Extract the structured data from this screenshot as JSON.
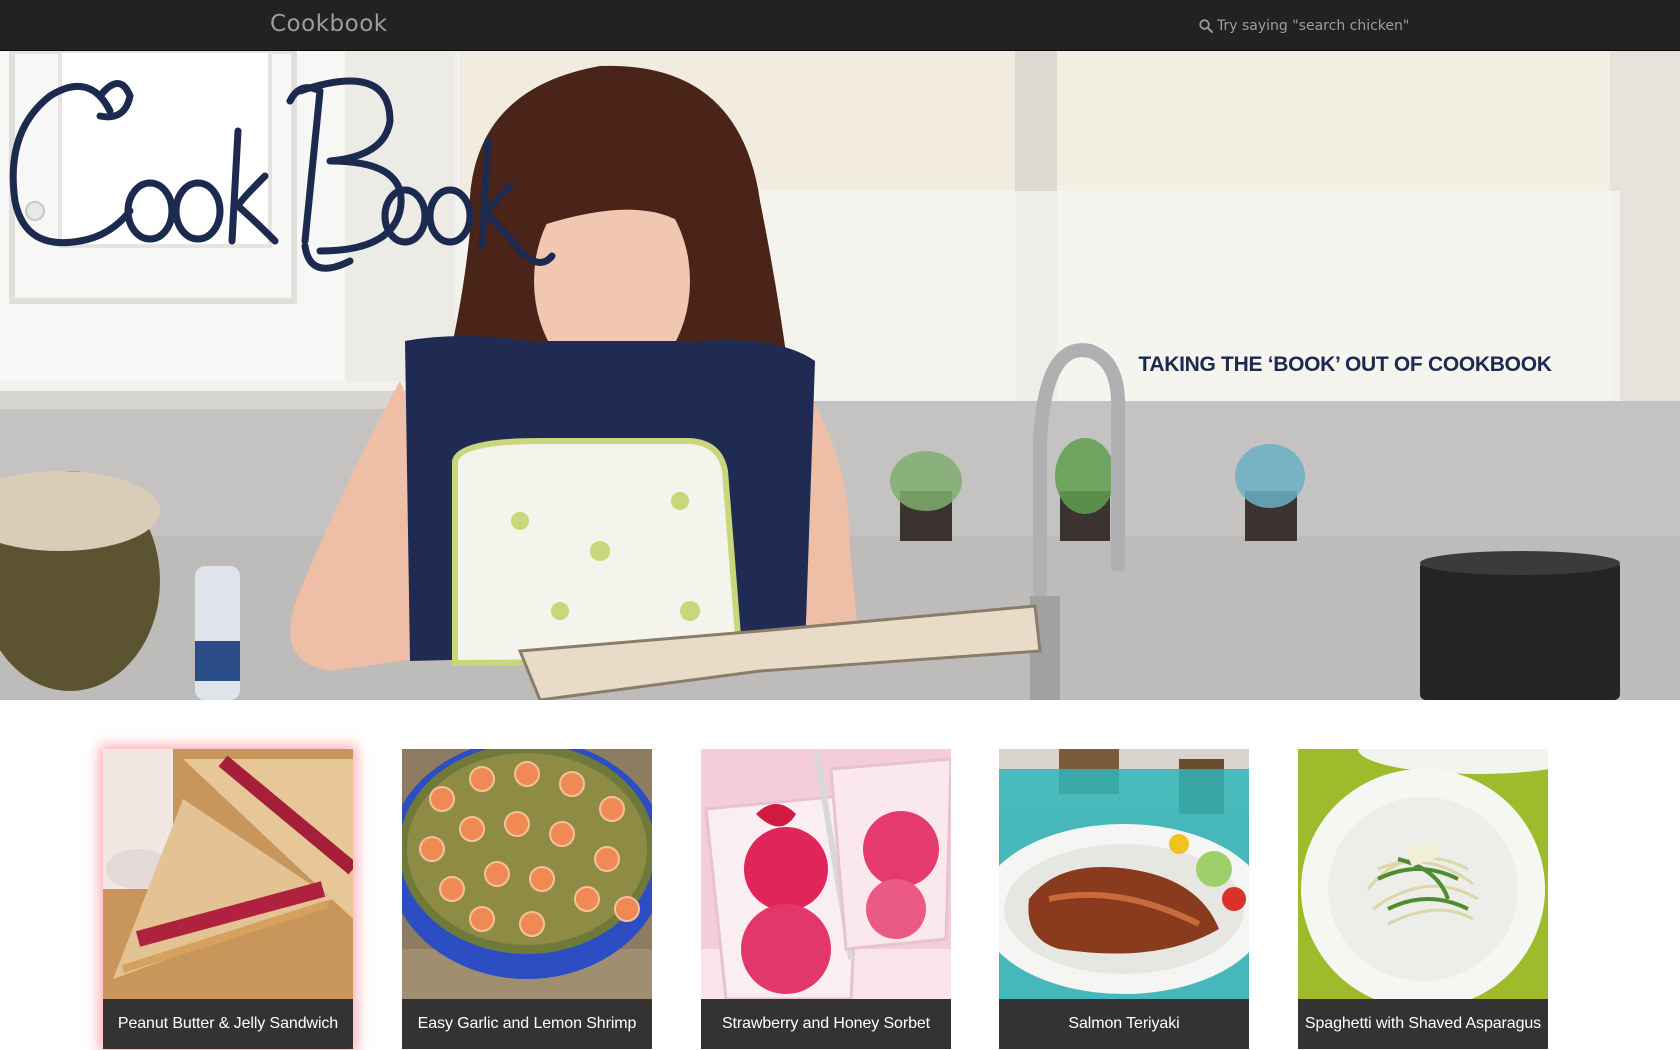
{
  "navbar": {
    "brand": "Cookbook",
    "search": {
      "icon": "search-icon",
      "placeholder": "Try saying \"search chicken\""
    }
  },
  "hero": {
    "logo_text": "CookBook",
    "tagline": "TAKING THE ‘BOOK’ OUT OF COOKBOOK",
    "logo_color": "#1c2a4f"
  },
  "recipes": [
    {
      "title": "Peanut Butter & Jelly Sandwich",
      "highlighted": true
    },
    {
      "title": "Easy Garlic and Lemon Shrimp",
      "highlighted": false
    },
    {
      "title": "Strawberry and Honey Sorbet",
      "highlighted": false
    },
    {
      "title": "Salmon Teriyaki",
      "highlighted": false
    },
    {
      "title": "Spaghetti with Shaved Asparagus",
      "highlighted": false
    }
  ]
}
